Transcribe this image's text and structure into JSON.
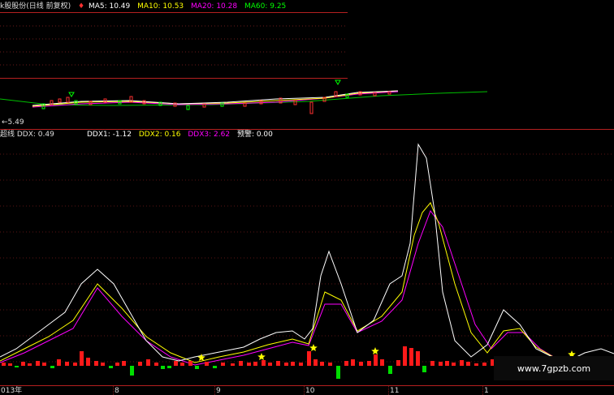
{
  "price_panel": {
    "title": "k股股份(日线 前复权)",
    "ma_items": [
      {
        "label": "MA5: 10.49",
        "color": "#ffffff"
      },
      {
        "label": "MA10: 10.53",
        "color": "#ffff00"
      },
      {
        "label": "MA20: 10.28",
        "color": "#ff00ff"
      },
      {
        "label": "MA60: 9.25",
        "color": "#00ff00"
      }
    ],
    "low_label": "←5.49",
    "marker_icon": "arrow-down-icon"
  },
  "indicator_panel": {
    "name": "超线 DDX: 0.49",
    "ddx_items": [
      {
        "label": "DDX1: -1.12",
        "color": "#ffffff"
      },
      {
        "label": "DDX2: 0.16",
        "color": "#ffff00"
      },
      {
        "label": "DDX3: 2.62",
        "color": "#ff00ff"
      },
      {
        "label": "预警: 0.00",
        "color": "#ffffff"
      }
    ],
    "signal_icon": "star-icon"
  },
  "x_axis": {
    "labels": [
      "013年",
      "8",
      "9",
      "10",
      "11",
      "1"
    ]
  },
  "watermark": "www.7gpzb.com",
  "chart_data": {
    "type": "line",
    "series": [
      {
        "name": "DDX1",
        "color": "#ffffff"
      },
      {
        "name": "DDX2",
        "color": "#ffff00"
      },
      {
        "name": "DDX3",
        "color": "#ff00ff"
      }
    ]
  }
}
